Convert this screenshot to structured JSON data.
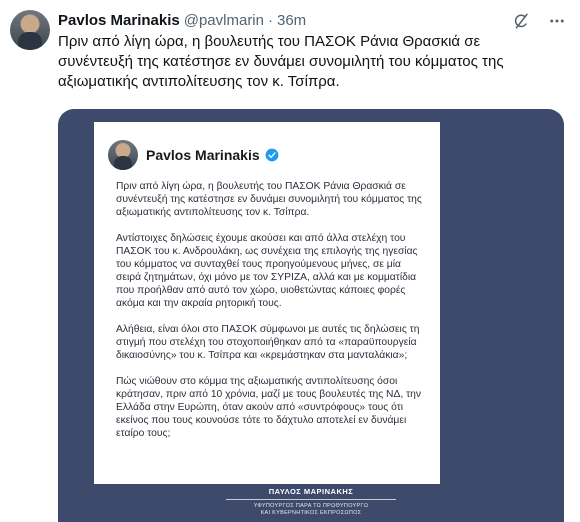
{
  "tweet": {
    "author_name": "Pavlos Marinakis",
    "handle": "@pavlmarin",
    "separator": "·",
    "time": "36m",
    "text": "Πριν από λίγη ώρα, η βουλευτής του ΠΑΣΟΚ Ράνια Θρασκιά σε συνέντευξή της κατέστησε εν δυνάμει συνομιλητή του κόμματος της αξιωματικής αντιπολίτευσης τον κ. Τσίπρα."
  },
  "icons": {
    "grok": "grok-icon",
    "more": "more-options-icon",
    "verified": "verified-badge-icon"
  },
  "colors": {
    "media_bg": "#3e4a6c",
    "verified_blue": "#1d9bf0",
    "muted_text": "#536471"
  },
  "media": {
    "card": {
      "name": "Pavlos Marinakis",
      "paragraphs": [
        "Πριν από λίγη ώρα, η βουλευτής του ΠΑΣΟΚ Ράνια Θρασκιά σε συνέντευξή της κατέστησε εν δυνάμει συνομιλητή του κόμματος της αξιωματικής αντιπολίτευσης τον κ. Τσίπρα.",
        "Αντίστοιχες δηλώσεις έχουμε ακούσει και από άλλα στελέχη του ΠΑΣΟΚ του κ. Ανδρουλάκη, ως συνέχεια της επιλογής της ηγεσίας του κόμματος να συνταχθεί τους προηγούμενους μήνες, σε μία σειρά ζητημάτων, όχι μόνο με τον ΣΥΡΙΖΑ, αλλά και με κομματίδια που προήλθαν από αυτό τον χώρο, υιοθετώντας κάποιες φορές ακόμα και την ακραία ρητορική τους.",
        "Αλήθεια, είναι όλοι στο ΠΑΣΟΚ σύμφωνοι με αυτές τις δηλώσεις τη στιγμή που στελέχη του στοχοποιήθηκαν από τα «παραϋπουργεία δικαιοσύνης» του κ. Τσίπρα και «κρεμάστηκαν στα μανταλάκια»;",
        "Πώς νιώθουν στο κόμμα της αξιωματικής αντιπολίτευσης όσοι κράτησαν, πριν από 10 χρόνια, μαζί με τους βουλευτές της ΝΔ, την Ελλάδα στην Ευρώπη, όταν ακούν από «συντρόφους» τους ότι εκείνος που τους κουνούσε τότε το δάχτυλο αποτελεί εν δυνάμει εταίρο τους;"
      ]
    },
    "footer": {
      "name": "ΠΑΥΛΟΣ ΜΑΡΙΝΑΚΗΣ",
      "role_line1": "ΥΦΥΠΟΥΡΓΟΣ ΠΑΡΑ ΤΩ ΠΡΩΘΥΠΟΥΡΓΩ",
      "role_line2": "ΚΑΙ ΚΥΒΕΡΝΗΤΙΚΟΣ ΕΚΠΡΟΣΩΠΟΣ"
    }
  }
}
